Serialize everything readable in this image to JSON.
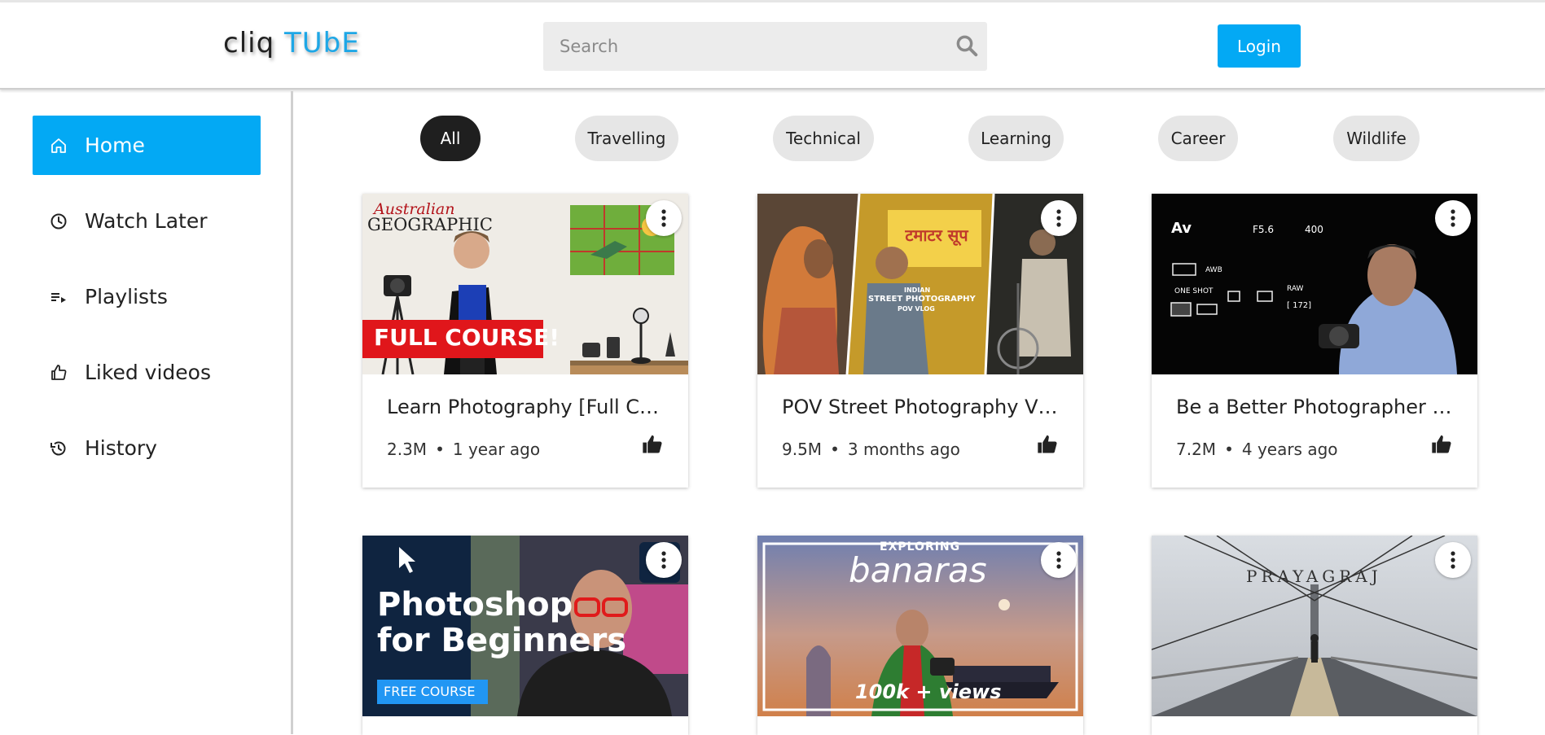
{
  "app": {
    "logo_part1": "cliq",
    "logo_part2": "TUbE"
  },
  "header": {
    "search_placeholder": "Search",
    "login_label": "Login"
  },
  "sidebar": {
    "items": [
      {
        "label": "Home",
        "icon": "home-icon",
        "active": true
      },
      {
        "label": "Watch Later",
        "icon": "clock-icon",
        "active": false
      },
      {
        "label": "Playlists",
        "icon": "playlist-icon",
        "active": false
      },
      {
        "label": "Liked videos",
        "icon": "thumbs-up-icon",
        "active": false
      },
      {
        "label": "History",
        "icon": "history-icon",
        "active": false
      }
    ]
  },
  "chips": [
    "All",
    "Travelling",
    "Technical",
    "Learning",
    "Career",
    "Wildlife"
  ],
  "videos": [
    {
      "title": "Learn Photography [Full Co...",
      "views": "2.3M",
      "age": "1 year ago",
      "thumb_texts": [
        "Australian",
        "GEOGRAPHIC",
        "FULL COURSE!"
      ]
    },
    {
      "title": "POV Street Photography Vlo...",
      "views": "9.5M",
      "age": "3 months ago",
      "thumb_texts": [
        "INDIAN",
        "STREET PHOTOGRAPHY",
        "POV VLOG"
      ]
    },
    {
      "title": "Be a Better Photographer in...",
      "views": "7.2M",
      "age": "4 years ago",
      "thumb_texts": [
        "Av",
        "F5.6",
        "400",
        "AWB",
        "ONE SHOT",
        "RAW",
        "[ 172]"
      ]
    },
    {
      "title": "",
      "views": "",
      "age": "",
      "thumb_texts": [
        "Photoshop",
        "for Beginners",
        "FREE COURSE"
      ]
    },
    {
      "title": "",
      "views": "",
      "age": "",
      "thumb_texts": [
        "EXPLORING",
        "banaras",
        "100k + views"
      ]
    },
    {
      "title": "",
      "views": "",
      "age": "",
      "thumb_texts": [
        "PRAYAGRAJ"
      ]
    }
  ],
  "colors": {
    "accent": "#03a9f4",
    "logo_blue": "#1ea7e6",
    "chip_active": "#1f1f1f",
    "chip_bg": "#e6e6e6"
  }
}
